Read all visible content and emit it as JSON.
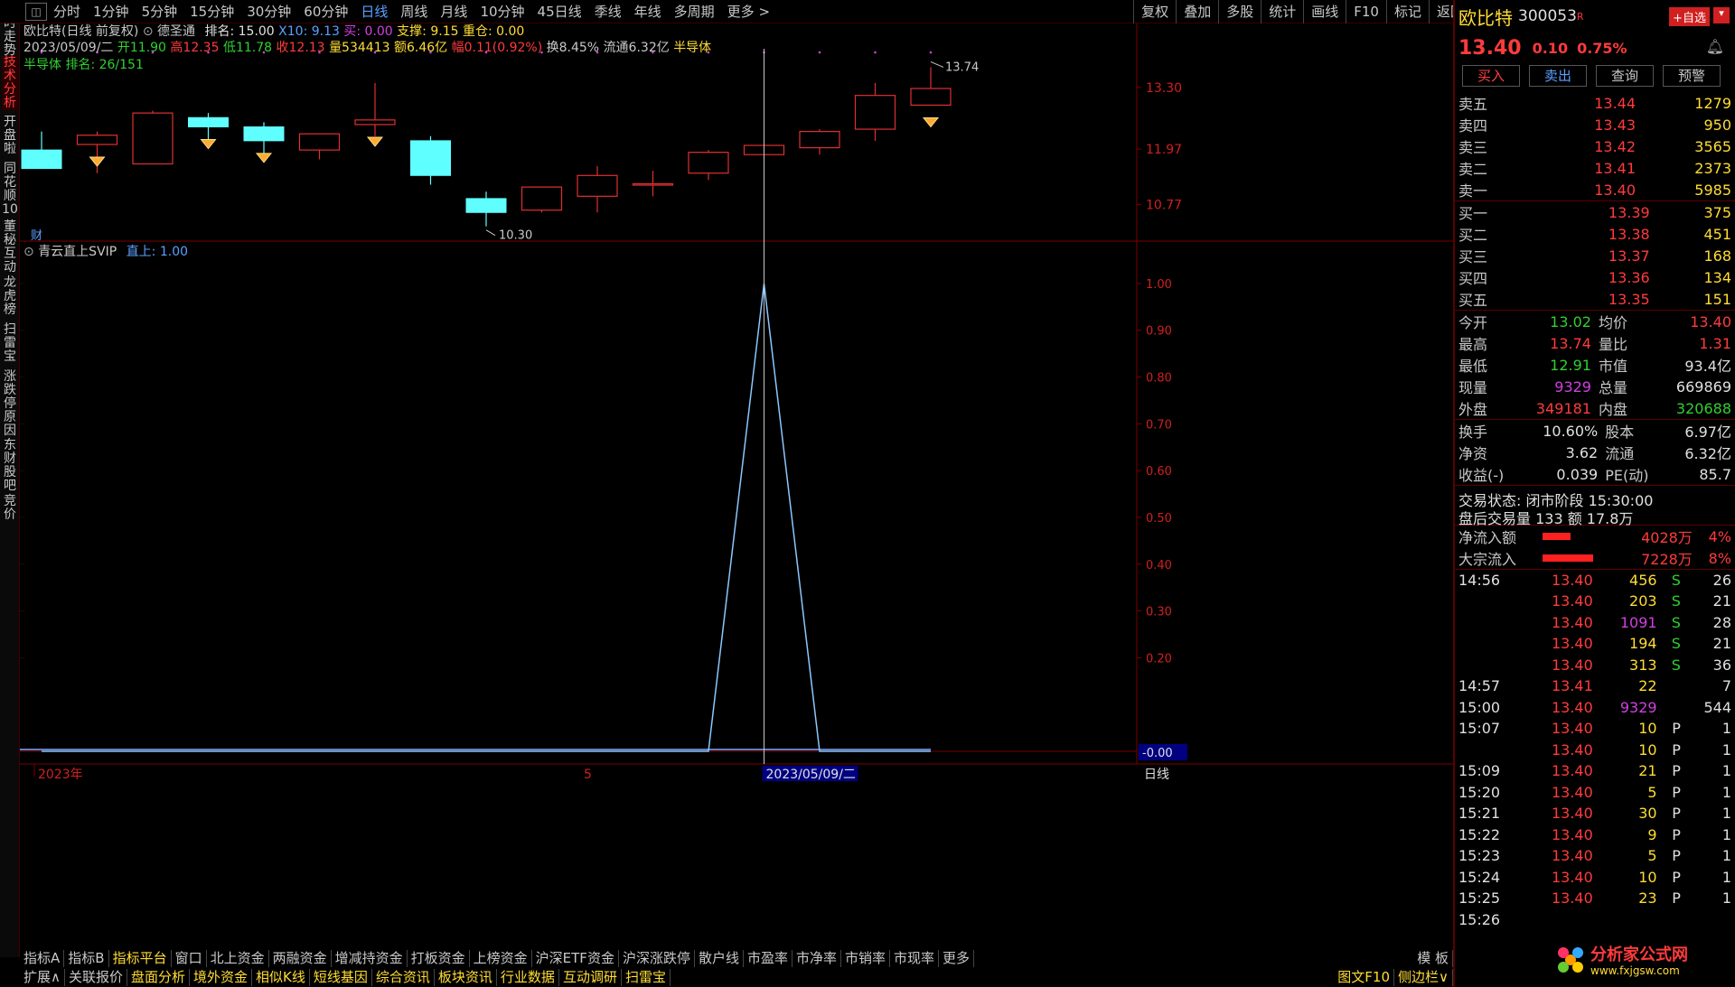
{
  "toolbar": {
    "timeframes": [
      "分时",
      "1分钟",
      "5分钟",
      "15分钟",
      "30分钟",
      "60分钟",
      "日线",
      "周线",
      "月线",
      "10分钟",
      "45日线",
      "季线",
      "年线",
      "多周期",
      "更多 >"
    ],
    "active_timeframe": "日线",
    "tools": [
      "复权",
      "叠加",
      "多股",
      "统计",
      "画线",
      "F10",
      "标记",
      "返回"
    ]
  },
  "left_tabs": [
    "分时走势",
    "技术分析",
    "开盘啦",
    "同花顺10",
    "董秘互动",
    "龙虎榜",
    "扫雷宝",
    "涨跌停原因",
    "东财股吧",
    "竞价"
  ],
  "active_left_tab": "技术分析",
  "chart_info": {
    "line1_title": "欧比特(日线 前复权)",
    "line1_label2": "德圣通",
    "rank_label": "排名: 15.00",
    "x10": "X10: 9.13",
    "buy": "买: 0.00",
    "support": "支撑: 9.15",
    "heavy": "重仓: 0.00",
    "date": "2023/05/09/二",
    "open": "开11.90",
    "high": "高12.35",
    "low": "低11.78",
    "close": "收12.13",
    "volume": "量534413",
    "amount": "额6.46亿",
    "amp": "幅0.11(0.92%)",
    "turnover": "换8.45%",
    "float": "流通6.32亿",
    "sector": "半导体",
    "sector_rank": "半导体 排名: 26/151",
    "high_label": "13.74",
    "low_label": "10.30",
    "cai_badge": "财",
    "y_ticks": [
      "13.30",
      "11.97",
      "10.77"
    ]
  },
  "indicator": {
    "name": "青云直上SVIP",
    "value_label": "直上: 1.00",
    "y_ticks": [
      "1.00",
      "0.90",
      "0.80",
      "0.70",
      "0.60",
      "0.50",
      "0.40",
      "0.30",
      "0.20"
    ],
    "zero_label": "-0.00"
  },
  "x_axis": {
    "year_label": "2023年",
    "month_label": "5",
    "cursor_date": "2023/05/09/二",
    "period_label": "日线"
  },
  "chart_data": {
    "type": "candlestick",
    "ylim": [
      10.0,
      14.1
    ],
    "candles": [
      {
        "o": 11.95,
        "c": 11.55,
        "h": 12.35,
        "l": 11.55
      },
      {
        "o": 12.07,
        "c": 12.27,
        "h": 12.35,
        "l": 11.45
      },
      {
        "o": 11.65,
        "c": 12.75,
        "h": 12.8,
        "l": 11.65
      },
      {
        "o": 12.65,
        "c": 12.45,
        "h": 12.75,
        "l": 12.15
      },
      {
        "o": 12.45,
        "c": 12.15,
        "h": 12.55,
        "l": 11.85
      },
      {
        "o": 11.95,
        "c": 12.3,
        "h": 12.3,
        "l": 11.75
      },
      {
        "o": 12.5,
        "c": 12.6,
        "h": 13.4,
        "l": 12.25
      },
      {
        "o": 12.15,
        "c": 11.4,
        "h": 12.25,
        "l": 11.2
      },
      {
        "o": 10.9,
        "c": 10.6,
        "h": 11.05,
        "l": 10.3
      },
      {
        "o": 10.65,
        "c": 11.15,
        "h": 11.15,
        "l": 10.6
      },
      {
        "o": 10.95,
        "c": 11.4,
        "h": 11.6,
        "l": 10.6
      },
      {
        "o": 11.2,
        "c": 11.22,
        "h": 11.5,
        "l": 10.95
      },
      {
        "o": 11.45,
        "c": 11.9,
        "h": 11.95,
        "l": 11.3
      },
      {
        "o": 11.85,
        "c": 12.05,
        "h": 12.05,
        "l": 11.85
      },
      {
        "o": 12.0,
        "c": 12.35,
        "h": 12.4,
        "l": 11.85
      },
      {
        "o": 12.4,
        "c": 13.13,
        "h": 13.4,
        "l": 12.15
      },
      {
        "o": 12.92,
        "c": 13.28,
        "h": 13.74,
        "l": 12.92
      }
    ],
    "diamond_candles": [
      1,
      3,
      4,
      6,
      16
    ],
    "indicator_values": [
      0,
      0,
      0,
      0,
      0,
      0,
      0,
      0,
      0,
      0,
      0,
      0,
      0,
      1.0,
      0,
      0,
      0
    ]
  },
  "quote": {
    "name": "欧比特",
    "code": "300053",
    "badge": "R",
    "add_fav": "+自选",
    "price": "13.40",
    "change": "0.10",
    "change_pct": "0.75%",
    "buttons": [
      "买入",
      "卖出",
      "查询",
      "预警"
    ],
    "asks": [
      {
        "label": "卖五",
        "price": "13.44",
        "vol": "1279"
      },
      {
        "label": "卖四",
        "price": "13.43",
        "vol": "950"
      },
      {
        "label": "卖三",
        "price": "13.42",
        "vol": "3565"
      },
      {
        "label": "卖二",
        "price": "13.41",
        "vol": "2373"
      },
      {
        "label": "卖一",
        "price": "13.40",
        "vol": "5985"
      }
    ],
    "bids": [
      {
        "label": "买一",
        "price": "13.39",
        "vol": "375"
      },
      {
        "label": "买二",
        "price": "13.38",
        "vol": "451"
      },
      {
        "label": "买三",
        "price": "13.37",
        "vol": "168"
      },
      {
        "label": "买四",
        "price": "13.36",
        "vol": "134"
      },
      {
        "label": "买五",
        "price": "13.35",
        "vol": "151"
      }
    ],
    "stats": [
      {
        "l1": "今开",
        "v1": "13.02",
        "c1": "g",
        "l2": "均价",
        "v2": "13.40",
        "c2": "r"
      },
      {
        "l1": "最高",
        "v1": "13.74",
        "c1": "r",
        "l2": "量比",
        "v2": "1.31",
        "c2": "r"
      },
      {
        "l1": "最低",
        "v1": "12.91",
        "c1": "g",
        "l2": "市值",
        "v2": "93.4亿",
        "c2": "w"
      },
      {
        "l1": "现量",
        "v1": "9329",
        "c1": "m",
        "l2": "总量",
        "v2": "669869",
        "c2": "w"
      },
      {
        "l1": "外盘",
        "v1": "349181",
        "c1": "r",
        "l2": "内盘",
        "v2": "320688",
        "c2": "g"
      }
    ],
    "stats2": [
      {
        "l1": "换手",
        "v1": "10.60%",
        "l2": "股本",
        "v2": "6.97亿"
      },
      {
        "l1": "净资",
        "v1": "3.62",
        "l2": "流通",
        "v2": "6.32亿"
      },
      {
        "l1": "收益(-)",
        "v1": "0.039",
        "l2": "PE(动)",
        "v2": "85.7"
      }
    ],
    "trade_status": "交易状态: 闭市阶段 15:30:00",
    "after_hours": "盘后交易量 133 额 17.8万",
    "net_inflow": {
      "label": "净流入额",
      "value": "4028万",
      "pct": "4%",
      "bar": 0.38
    },
    "block_inflow": {
      "label": "大宗流入",
      "value": "7228万",
      "pct": "8%",
      "bar": 0.68
    }
  },
  "ticks": [
    {
      "t": "14:56",
      "p": "13.40",
      "v": "456",
      "vc": "y",
      "bs": "S",
      "n": "26"
    },
    {
      "t": "",
      "p": "13.40",
      "v": "203",
      "vc": "y",
      "bs": "S",
      "n": "21"
    },
    {
      "t": "",
      "p": "13.40",
      "v": "1091",
      "vc": "m",
      "bs": "S",
      "n": "28"
    },
    {
      "t": "",
      "p": "13.40",
      "v": "194",
      "vc": "y",
      "bs": "S",
      "n": "21"
    },
    {
      "t": "",
      "p": "13.40",
      "v": "313",
      "vc": "y",
      "bs": "S",
      "n": "36"
    },
    {
      "t": "14:57",
      "p": "13.41",
      "v": "22",
      "vc": "y",
      "bs": "",
      "n": "7"
    },
    {
      "t": "15:00",
      "p": "13.40",
      "v": "9329",
      "vc": "m",
      "bs": "",
      "n": "544"
    },
    {
      "t": "15:07",
      "p": "13.40",
      "v": "10",
      "vc": "y",
      "bs": "P",
      "n": "1"
    },
    {
      "t": "",
      "p": "13.40",
      "v": "10",
      "vc": "y",
      "bs": "P",
      "n": "1"
    },
    {
      "t": "15:09",
      "p": "13.40",
      "v": "21",
      "vc": "y",
      "bs": "P",
      "n": "1"
    },
    {
      "t": "15:20",
      "p": "13.40",
      "v": "5",
      "vc": "y",
      "bs": "P",
      "n": "1"
    },
    {
      "t": "15:21",
      "p": "13.40",
      "v": "30",
      "vc": "y",
      "bs": "P",
      "n": "1"
    },
    {
      "t": "15:22",
      "p": "13.40",
      "v": "9",
      "vc": "y",
      "bs": "P",
      "n": "1"
    },
    {
      "t": "15:23",
      "p": "13.40",
      "v": "5",
      "vc": "y",
      "bs": "P",
      "n": "1"
    },
    {
      "t": "15:24",
      "p": "13.40",
      "v": "10",
      "vc": "y",
      "bs": "P",
      "n": "1"
    },
    {
      "t": "15:25",
      "p": "13.40",
      "v": "23",
      "vc": "y",
      "bs": "P",
      "n": "1"
    },
    {
      "t": "15:26",
      "p": "",
      "v": "",
      "vc": "y",
      "bs": "",
      "n": ""
    }
  ],
  "bottom_tabs1": [
    "指标A",
    "指标B",
    "指标平台",
    "窗口",
    "北上资金",
    "两融资金",
    "增减持资金",
    "打板资金",
    "上榜资金",
    "沪深ETF资金",
    "沪深涨跌停",
    "散户线",
    "市盈率",
    "市净率",
    "市销率",
    "市现率",
    "更多"
  ],
  "bottom_tabs1_right": "模 板",
  "bottom_tabs2": [
    "扩展∧",
    "关联报价",
    "盘面分析",
    "境外资金",
    "相似K线",
    "短线基因",
    "综合资讯",
    "板块资讯",
    "行业数据",
    "互动调研",
    "扫雷宝"
  ],
  "bottom_tabs2_right": [
    "图文F10",
    "侧边栏∨"
  ],
  "watermark": "分析家公式网",
  "watermark_url": "www.fxjgsw.com"
}
